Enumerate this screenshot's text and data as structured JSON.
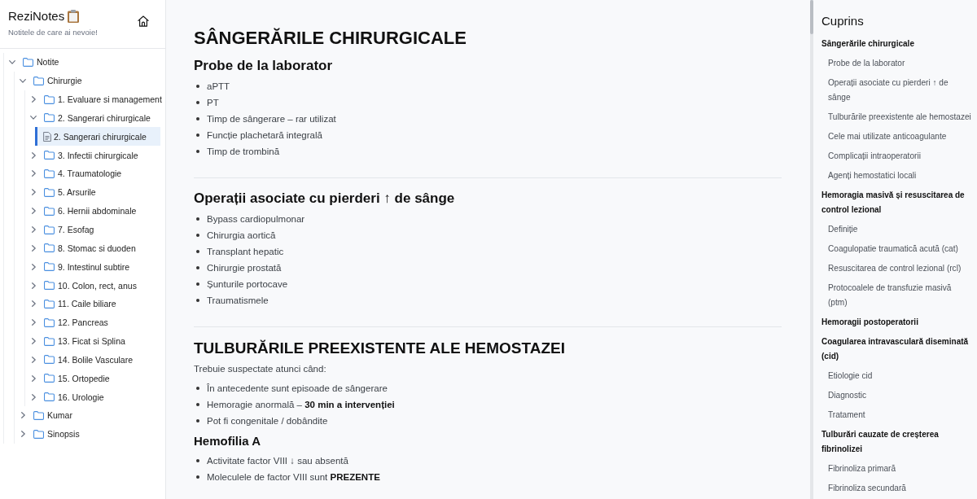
{
  "sidebar": {
    "title": "ReziNotes",
    "subtitle": "Notitele de care ai nevoie!",
    "tree": [
      {
        "kind": "folder",
        "label": "Notite",
        "expanded": true,
        "selected": false,
        "children": [
          {
            "kind": "folder",
            "label": "Chirurgie",
            "expanded": true,
            "selected": false,
            "children": [
              {
                "kind": "folder",
                "label": "1. Evaluare si management",
                "expanded": false,
                "selected": false
              },
              {
                "kind": "folder",
                "label": "2. Sangerari chirurgicale",
                "expanded": true,
                "selected": false,
                "children": [
                  {
                    "kind": "file",
                    "label": "2. Sangerari chirurgicale",
                    "selected": true
                  }
                ]
              },
              {
                "kind": "folder",
                "label": "3. Infectii chirurgicale",
                "expanded": false,
                "selected": false
              },
              {
                "kind": "folder",
                "label": "4. Traumatologie",
                "expanded": false,
                "selected": false
              },
              {
                "kind": "folder",
                "label": "5. Arsurile",
                "expanded": false,
                "selected": false
              },
              {
                "kind": "folder",
                "label": "6. Hernii abdominale",
                "expanded": false,
                "selected": false
              },
              {
                "kind": "folder",
                "label": "7. Esofag",
                "expanded": false,
                "selected": false
              },
              {
                "kind": "folder",
                "label": "8. Stomac si duoden",
                "expanded": false,
                "selected": false
              },
              {
                "kind": "folder",
                "label": "9. Intestinul subtire",
                "expanded": false,
                "selected": false
              },
              {
                "kind": "folder",
                "label": "10. Colon, rect, anus",
                "expanded": false,
                "selected": false
              },
              {
                "kind": "folder",
                "label": "11. Caile biliare",
                "expanded": false,
                "selected": false
              },
              {
                "kind": "folder",
                "label": "12. Pancreas",
                "expanded": false,
                "selected": false
              },
              {
                "kind": "folder",
                "label": "13. Ficat si Splina",
                "expanded": false,
                "selected": false
              },
              {
                "kind": "folder",
                "label": "14. Bolile Vasculare",
                "expanded": false,
                "selected": false
              },
              {
                "kind": "folder",
                "label": "15. Ortopedie",
                "expanded": false,
                "selected": false
              },
              {
                "kind": "folder",
                "label": "16. Urologie",
                "expanded": false,
                "selected": false
              }
            ]
          },
          {
            "kind": "folder",
            "label": "Kumar",
            "expanded": false,
            "selected": false
          },
          {
            "kind": "folder",
            "label": "Sinopsis",
            "expanded": false,
            "selected": false
          }
        ]
      }
    ]
  },
  "article": {
    "blocks": [
      {
        "kind": "h1",
        "text": "SÂNGERĂRILE CHIRURGICALE"
      },
      {
        "kind": "h3",
        "text": "Probe de la laborator"
      },
      {
        "kind": "list",
        "items": [
          "aPTT",
          "PT",
          "Timp de sângerare – rar utilizat",
          "Funcție plachetară integrală",
          "Timp de trombină"
        ]
      },
      {
        "kind": "rule"
      },
      {
        "kind": "h3",
        "text": "Operații asociate cu pierderi ↑ de sânge"
      },
      {
        "kind": "list",
        "items": [
          "Bypass cardiopulmonar",
          "Chirurgia aortică",
          "Transplant hepatic",
          "Chirurgie prostată",
          "Șunturile portocave",
          "Traumatismele"
        ]
      },
      {
        "kind": "rule"
      },
      {
        "kind": "h2",
        "text": "TULBURĂRILE PREEXISTENTE ALE HEMOSTAZEI"
      },
      {
        "kind": "paragraph",
        "text": "Trebuie suspectate atunci când:"
      },
      {
        "kind": "list",
        "items": [
          "În antecedente sunt episoade de sângerare",
          "Hemoragie anormală – **30 min a intervenției**",
          "Pot fi congenitale / dobândite"
        ]
      },
      {
        "kind": "h4",
        "text": "Hemofilia A"
      },
      {
        "kind": "list",
        "items": [
          "Activitate factor VIII ↓ sau absentă",
          "Moleculele de factor VIII sunt **PREZENTE**"
        ]
      }
    ]
  },
  "toc": {
    "title": "Cuprins",
    "items": [
      {
        "text": "Sângerările chirurgicale",
        "children": [
          {
            "text": "Probe de la laborator"
          },
          {
            "text": "Operații asociate cu pierderi ↑ de sânge"
          },
          {
            "text": "Tulburările preexistente ale hemostazei"
          },
          {
            "text": "Cele mai utilizate anticoagulante"
          },
          {
            "text": "Complicații intraoperatorii"
          },
          {
            "text": "Agenți hemostatici locali"
          }
        ]
      },
      {
        "text": "Hemoragia masivă și resuscitarea de control lezional",
        "children": [
          {
            "text": "Definiție"
          },
          {
            "text": "Coagulopatie traumatică acută (cat)"
          },
          {
            "text": "Resuscitarea de control lezional (rcl)"
          },
          {
            "text": "Protocoalele de transfuzie masivă (ptm)"
          }
        ]
      },
      {
        "text": "Hemoragii postoperatorii"
      },
      {
        "text": "Coagularea intravasculară diseminată (cid)",
        "children": [
          {
            "text": "Etiologie cid"
          },
          {
            "text": "Diagnostic"
          },
          {
            "text": "Tratament"
          }
        ]
      },
      {
        "text": "Tulburări cauzate de creșterea fibrinolizei",
        "children": [
          {
            "text": "Fibrinoliza primară"
          },
          {
            "text": "Fibrinoliza secundară"
          }
        ]
      }
    ]
  }
}
